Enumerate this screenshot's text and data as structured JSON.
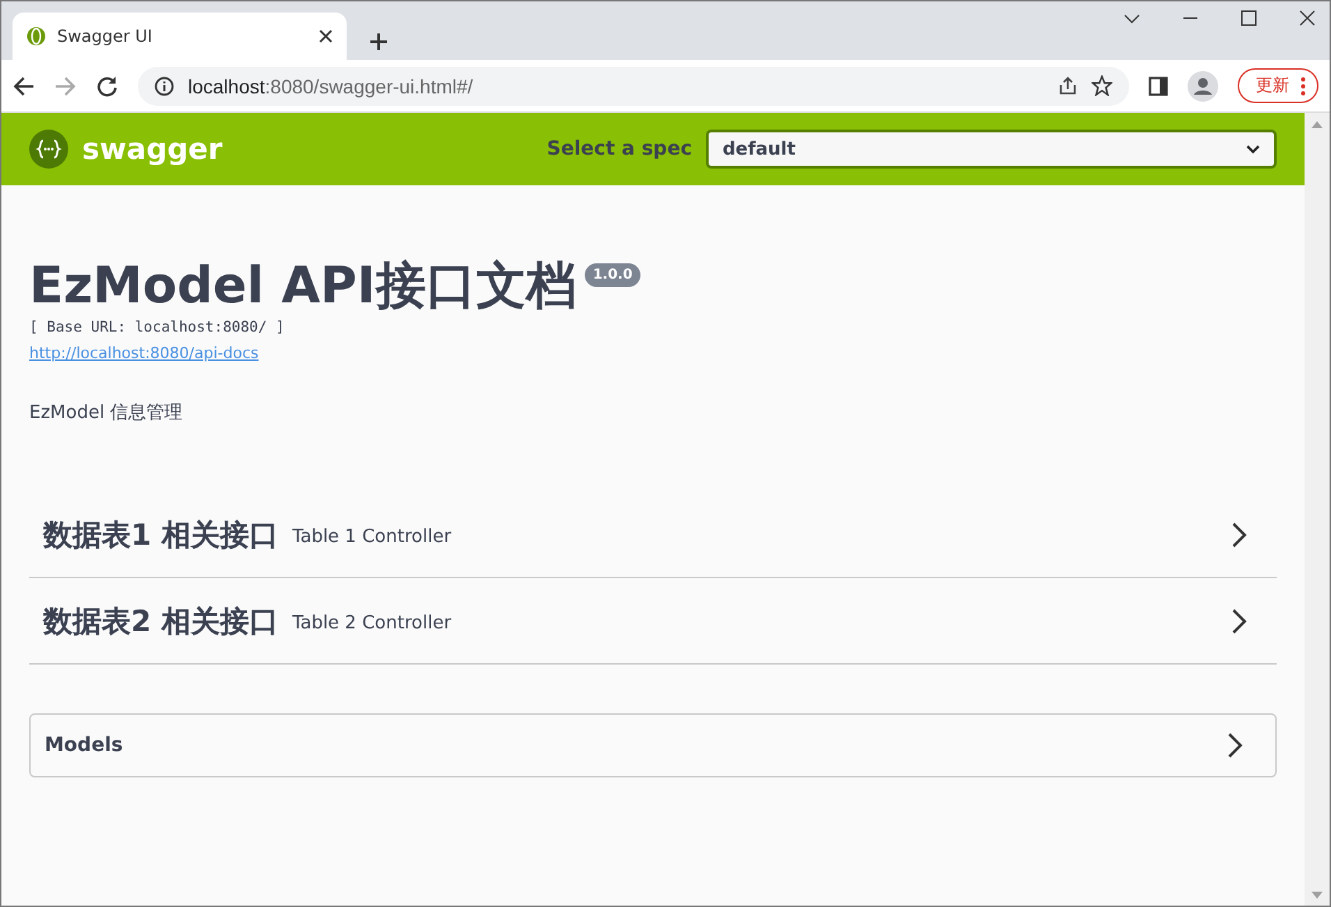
{
  "browser": {
    "tab": {
      "title": "Swagger UI",
      "selected": true
    },
    "url": {
      "host": "localhost",
      "rest": ":8080/swagger-ui.html#/"
    },
    "update_button": "更新"
  },
  "topbar": {
    "logo": "swagger",
    "spec_label": "Select a spec",
    "spec_value": "default"
  },
  "info": {
    "title": "EzModel API接口文档",
    "version": "1.0.0",
    "base_url": "[ Base URL: localhost:8080/ ]",
    "docs_link": "http://localhost:8080/api-docs",
    "description": "EzModel 信息管理"
  },
  "sections": [
    {
      "name": "数据表1 相关接口",
      "description": "Table 1 Controller",
      "expanded": false
    },
    {
      "name": "数据表2 相关接口",
      "description": "Table 2 Controller",
      "expanded": false
    }
  ],
  "models": {
    "title": "Models",
    "expanded": false
  }
}
